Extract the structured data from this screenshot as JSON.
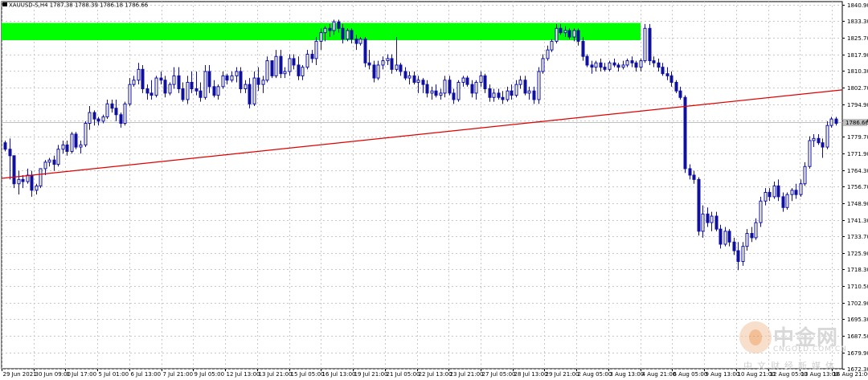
{
  "chart_data": {
    "type": "candlestick",
    "title": "XAUUSD-S,H4  1787.38 1788.39 1786.18 1786.66",
    "last_price": 1786.66,
    "y_ticks": [
      1840.9,
      1833.3,
      1825.7,
      1817.9,
      1810.3,
      1802.7,
      1794.9,
      1787.3,
      1779.7,
      1771.9,
      1764.3,
      1756.7,
      1748.9,
      1741.3,
      1733.7,
      1725.9,
      1718.3,
      1710.5,
      1702.9,
      1695.3,
      1687.5,
      1679.9,
      1672.3
    ],
    "x_ticks": [
      "29 Jun 2021",
      "30 Jun 09:00",
      "1 Jul 17:00",
      "5 Jul 01:00",
      "6 Jul 13:00",
      "7 Jul 21:00",
      "9 Jul 05:00",
      "12 Jul 13:00",
      "13 Jul 21:00",
      "15 Jul 05:00",
      "16 Jul 13:00",
      "19 Jul 21:00",
      "21 Jul 05:00",
      "22 Jul 13:00",
      "23 Jul 21:00",
      "27 Jul 05:00",
      "28 Jul 13:00",
      "29 Jul 21:00",
      "2 Aug 05:00",
      "3 Aug 13:00",
      "4 Aug 21:00",
      "6 Aug 05:00",
      "9 Aug 13:00",
      "10 Aug 21:00",
      "12 Aug 05:00",
      "13 Aug 13:00",
      "16 Aug 21:00"
    ],
    "ylim": [
      1672.3,
      1840.9
    ],
    "resistance_zone": {
      "from": 1824.5,
      "to": 1832.5,
      "color": "#00ff00"
    },
    "trendline": {
      "color": "#e00000",
      "start_price": 1760.5,
      "end_price": 1801.5
    },
    "current_price_line_color": "#c0c0c0",
    "candle_color": "#1010a0",
    "candles": [
      [
        1777,
        1778,
        1773,
        1774
      ],
      [
        1774,
        1779,
        1760,
        1771
      ],
      [
        1771,
        1771,
        1756,
        1758
      ],
      [
        1758,
        1764,
        1753,
        1760
      ],
      [
        1760,
        1762,
        1756,
        1759
      ],
      [
        1759,
        1765,
        1758,
        1762
      ],
      [
        1762,
        1764,
        1752,
        1755
      ],
      [
        1755,
        1758,
        1753,
        1757
      ],
      [
        1757,
        1765,
        1756,
        1765
      ],
      [
        1765,
        1769,
        1762,
        1768
      ],
      [
        1768,
        1770,
        1766,
        1769
      ],
      [
        1769,
        1771,
        1764,
        1767
      ],
      [
        1767,
        1776,
        1766,
        1774
      ],
      [
        1774,
        1778,
        1772,
        1776
      ],
      [
        1776,
        1778,
        1771,
        1773
      ],
      [
        1773,
        1782,
        1772,
        1781
      ],
      [
        1781,
        1782,
        1774,
        1775
      ],
      [
        1775,
        1778,
        1772,
        1776
      ],
      [
        1776,
        1787,
        1775,
        1786
      ],
      [
        1786,
        1794,
        1783,
        1791
      ],
      [
        1791,
        1792,
        1785,
        1788
      ],
      [
        1788,
        1789,
        1785,
        1787
      ],
      [
        1787,
        1790,
        1786,
        1789
      ],
      [
        1789,
        1797,
        1788,
        1795
      ],
      [
        1795,
        1797,
        1791,
        1793
      ],
      [
        1793,
        1797,
        1787,
        1790
      ],
      [
        1790,
        1791,
        1784,
        1786
      ],
      [
        1786,
        1796,
        1785,
        1795
      ],
      [
        1795,
        1807,
        1794,
        1804
      ],
      [
        1804,
        1808,
        1803,
        1806
      ],
      [
        1806,
        1814,
        1804,
        1811
      ],
      [
        1811,
        1813,
        1800,
        1802
      ],
      [
        1802,
        1804,
        1797,
        1800
      ],
      [
        1800,
        1806,
        1797,
        1799
      ],
      [
        1799,
        1808,
        1798,
        1807
      ],
      [
        1807,
        1810,
        1804,
        1806
      ],
      [
        1806,
        1808,
        1798,
        1800
      ],
      [
        1800,
        1805,
        1799,
        1804
      ],
      [
        1804,
        1812,
        1802,
        1808
      ],
      [
        1808,
        1812,
        1800,
        1802
      ],
      [
        1802,
        1805,
        1796,
        1797
      ],
      [
        1797,
        1808,
        1795,
        1805
      ],
      [
        1805,
        1810,
        1800,
        1802
      ],
      [
        1802,
        1810,
        1799,
        1801
      ],
      [
        1801,
        1805,
        1796,
        1798
      ],
      [
        1798,
        1813,
        1797,
        1810
      ],
      [
        1810,
        1813,
        1800,
        1803
      ],
      [
        1803,
        1806,
        1798,
        1799
      ],
      [
        1799,
        1804,
        1797,
        1803
      ],
      [
        1803,
        1810,
        1802,
        1808
      ],
      [
        1808,
        1809,
        1804,
        1806
      ],
      [
        1806,
        1810,
        1805,
        1808
      ],
      [
        1808,
        1812,
        1805,
        1810
      ],
      [
        1810,
        1812,
        1800,
        1802
      ],
      [
        1802,
        1806,
        1800,
        1804
      ],
      [
        1804,
        1807,
        1793,
        1795
      ],
      [
        1795,
        1810,
        1794,
        1807
      ],
      [
        1807,
        1812,
        1801,
        1804
      ],
      [
        1804,
        1808,
        1800,
        1806
      ],
      [
        1806,
        1817,
        1805,
        1815
      ],
      [
        1815,
        1815,
        1807,
        1808
      ],
      [
        1808,
        1820,
        1807,
        1817
      ],
      [
        1817,
        1820,
        1807,
        1809
      ],
      [
        1809,
        1812,
        1807,
        1810
      ],
      [
        1810,
        1818,
        1808,
        1816
      ],
      [
        1816,
        1818,
        1811,
        1813
      ],
      [
        1813,
        1817,
        1806,
        1808
      ],
      [
        1808,
        1813,
        1806,
        1812
      ],
      [
        1812,
        1820,
        1811,
        1818
      ],
      [
        1818,
        1820,
        1814,
        1816
      ],
      [
        1816,
        1826,
        1813,
        1824
      ],
      [
        1824,
        1830,
        1820,
        1828
      ],
      [
        1828,
        1831,
        1824,
        1830
      ],
      [
        1830,
        1832,
        1826,
        1829
      ],
      [
        1829,
        1834,
        1827,
        1833
      ],
      [
        1833,
        1834,
        1828,
        1830
      ],
      [
        1830,
        1832,
        1823,
        1825
      ],
      [
        1825,
        1830,
        1824,
        1829
      ],
      [
        1829,
        1830,
        1823,
        1825
      ],
      [
        1825,
        1827,
        1820,
        1823
      ],
      [
        1823,
        1826,
        1822,
        1825
      ],
      [
        1825,
        1826,
        1812,
        1814
      ],
      [
        1814,
        1820,
        1811,
        1813
      ],
      [
        1813,
        1815,
        1805,
        1807
      ],
      [
        1807,
        1815,
        1806,
        1813
      ],
      [
        1813,
        1817,
        1811,
        1815
      ],
      [
        1815,
        1818,
        1813,
        1816
      ],
      [
        1816,
        1818,
        1809,
        1811
      ],
      [
        1811,
        1826,
        1810,
        1813
      ],
      [
        1813,
        1814,
        1808,
        1810
      ],
      [
        1810,
        1812,
        1806,
        1807
      ],
      [
        1807,
        1810,
        1804,
        1808
      ],
      [
        1808,
        1810,
        1804,
        1805
      ],
      [
        1805,
        1808,
        1800,
        1806
      ],
      [
        1806,
        1807,
        1800,
        1804
      ],
      [
        1804,
        1806,
        1798,
        1800
      ],
      [
        1800,
        1803,
        1797,
        1801
      ],
      [
        1801,
        1804,
        1798,
        1799
      ],
      [
        1799,
        1802,
        1797,
        1800
      ],
      [
        1800,
        1808,
        1798,
        1806
      ],
      [
        1806,
        1808,
        1799,
        1800
      ],
      [
        1800,
        1802,
        1795,
        1797
      ],
      [
        1797,
        1806,
        1796,
        1805
      ],
      [
        1805,
        1808,
        1803,
        1807
      ],
      [
        1807,
        1808,
        1803,
        1804
      ],
      [
        1804,
        1806,
        1798,
        1800
      ],
      [
        1800,
        1806,
        1797,
        1805
      ],
      [
        1805,
        1810,
        1803,
        1808
      ],
      [
        1808,
        1809,
        1800,
        1802
      ],
      [
        1802,
        1804,
        1796,
        1798
      ],
      [
        1798,
        1802,
        1796,
        1800
      ],
      [
        1800,
        1802,
        1797,
        1798
      ],
      [
        1798,
        1801,
        1795,
        1797
      ],
      [
        1797,
        1803,
        1796,
        1801
      ],
      [
        1801,
        1804,
        1797,
        1799
      ],
      [
        1799,
        1806,
        1798,
        1804
      ],
      [
        1804,
        1808,
        1802,
        1806
      ],
      [
        1806,
        1808,
        1799,
        1800
      ],
      [
        1800,
        1803,
        1797,
        1801
      ],
      [
        1801,
        1803,
        1795,
        1797
      ],
      [
        1797,
        1812,
        1795,
        1810
      ],
      [
        1810,
        1818,
        1809,
        1816
      ],
      [
        1816,
        1822,
        1815,
        1820
      ],
      [
        1820,
        1825,
        1819,
        1824
      ],
      [
        1824,
        1832,
        1823,
        1830
      ],
      [
        1830,
        1832,
        1827,
        1828
      ],
      [
        1828,
        1831,
        1826,
        1829
      ],
      [
        1829,
        1830,
        1825,
        1826
      ],
      [
        1826,
        1830,
        1824,
        1829
      ],
      [
        1829,
        1830,
        1822,
        1824
      ],
      [
        1824,
        1826,
        1815,
        1817
      ],
      [
        1817,
        1818,
        1812,
        1813
      ],
      [
        1813,
        1815,
        1809,
        1812
      ],
      [
        1812,
        1815,
        1810,
        1814
      ],
      [
        1814,
        1816,
        1810,
        1812
      ],
      [
        1812,
        1814,
        1810,
        1811
      ],
      [
        1811,
        1815,
        1810,
        1814
      ],
      [
        1814,
        1816,
        1812,
        1813
      ],
      [
        1813,
        1814,
        1810,
        1812
      ],
      [
        1812,
        1815,
        1811,
        1813
      ],
      [
        1813,
        1816,
        1812,
        1815
      ],
      [
        1815,
        1817,
        1812,
        1814
      ],
      [
        1814,
        1815,
        1810,
        1812
      ],
      [
        1812,
        1816,
        1810,
        1815
      ],
      [
        1815,
        1832,
        1814,
        1830
      ],
      [
        1830,
        1832,
        1813,
        1815
      ],
      [
        1815,
        1817,
        1812,
        1814
      ],
      [
        1814,
        1816,
        1810,
        1812
      ],
      [
        1812,
        1814,
        1808,
        1809
      ],
      [
        1809,
        1812,
        1806,
        1808
      ],
      [
        1808,
        1810,
        1803,
        1805
      ],
      [
        1805,
        1806,
        1800,
        1801
      ],
      [
        1801,
        1803,
        1797,
        1798
      ],
      [
        1798,
        1799,
        1763,
        1765
      ],
      [
        1765,
        1767,
        1760,
        1762
      ],
      [
        1762,
        1764,
        1758,
        1760
      ],
      [
        1760,
        1761,
        1734,
        1736
      ],
      [
        1736,
        1748,
        1733,
        1744
      ],
      [
        1744,
        1747,
        1738,
        1740
      ],
      [
        1740,
        1745,
        1736,
        1743
      ],
      [
        1743,
        1745,
        1736,
        1737
      ],
      [
        1737,
        1739,
        1728,
        1730
      ],
      [
        1730,
        1738,
        1729,
        1736
      ],
      [
        1736,
        1737,
        1729,
        1731
      ],
      [
        1731,
        1733,
        1725,
        1727
      ],
      [
        1727,
        1731,
        1718,
        1722
      ],
      [
        1722,
        1731,
        1720,
        1729
      ],
      [
        1729,
        1737,
        1727,
        1735
      ],
      [
        1735,
        1738,
        1731,
        1733
      ],
      [
        1733,
        1742,
        1732,
        1740
      ],
      [
        1740,
        1752,
        1738,
        1750
      ],
      [
        1750,
        1756,
        1748,
        1754
      ],
      [
        1754,
        1756,
        1750,
        1752
      ],
      [
        1752,
        1759,
        1751,
        1757
      ],
      [
        1757,
        1760,
        1750,
        1752
      ],
      [
        1752,
        1754,
        1745,
        1747
      ],
      [
        1747,
        1754,
        1746,
        1753
      ],
      [
        1753,
        1756,
        1750,
        1755
      ],
      [
        1755,
        1758,
        1751,
        1753
      ],
      [
        1753,
        1760,
        1752,
        1758
      ],
      [
        1758,
        1768,
        1757,
        1766
      ],
      [
        1766,
        1780,
        1765,
        1778
      ],
      [
        1778,
        1781,
        1775,
        1779
      ],
      [
        1779,
        1781,
        1776,
        1777
      ],
      [
        1777,
        1779,
        1770,
        1775
      ],
      [
        1775,
        1787,
        1774,
        1785
      ],
      [
        1785,
        1789,
        1784,
        1788
      ],
      [
        1788,
        1789,
        1785,
        1786
      ]
    ]
  },
  "watermark": {
    "title": "中金网",
    "domain": "CNGOLD.COM.CN",
    "subtitle": "中文财经新媒体"
  }
}
